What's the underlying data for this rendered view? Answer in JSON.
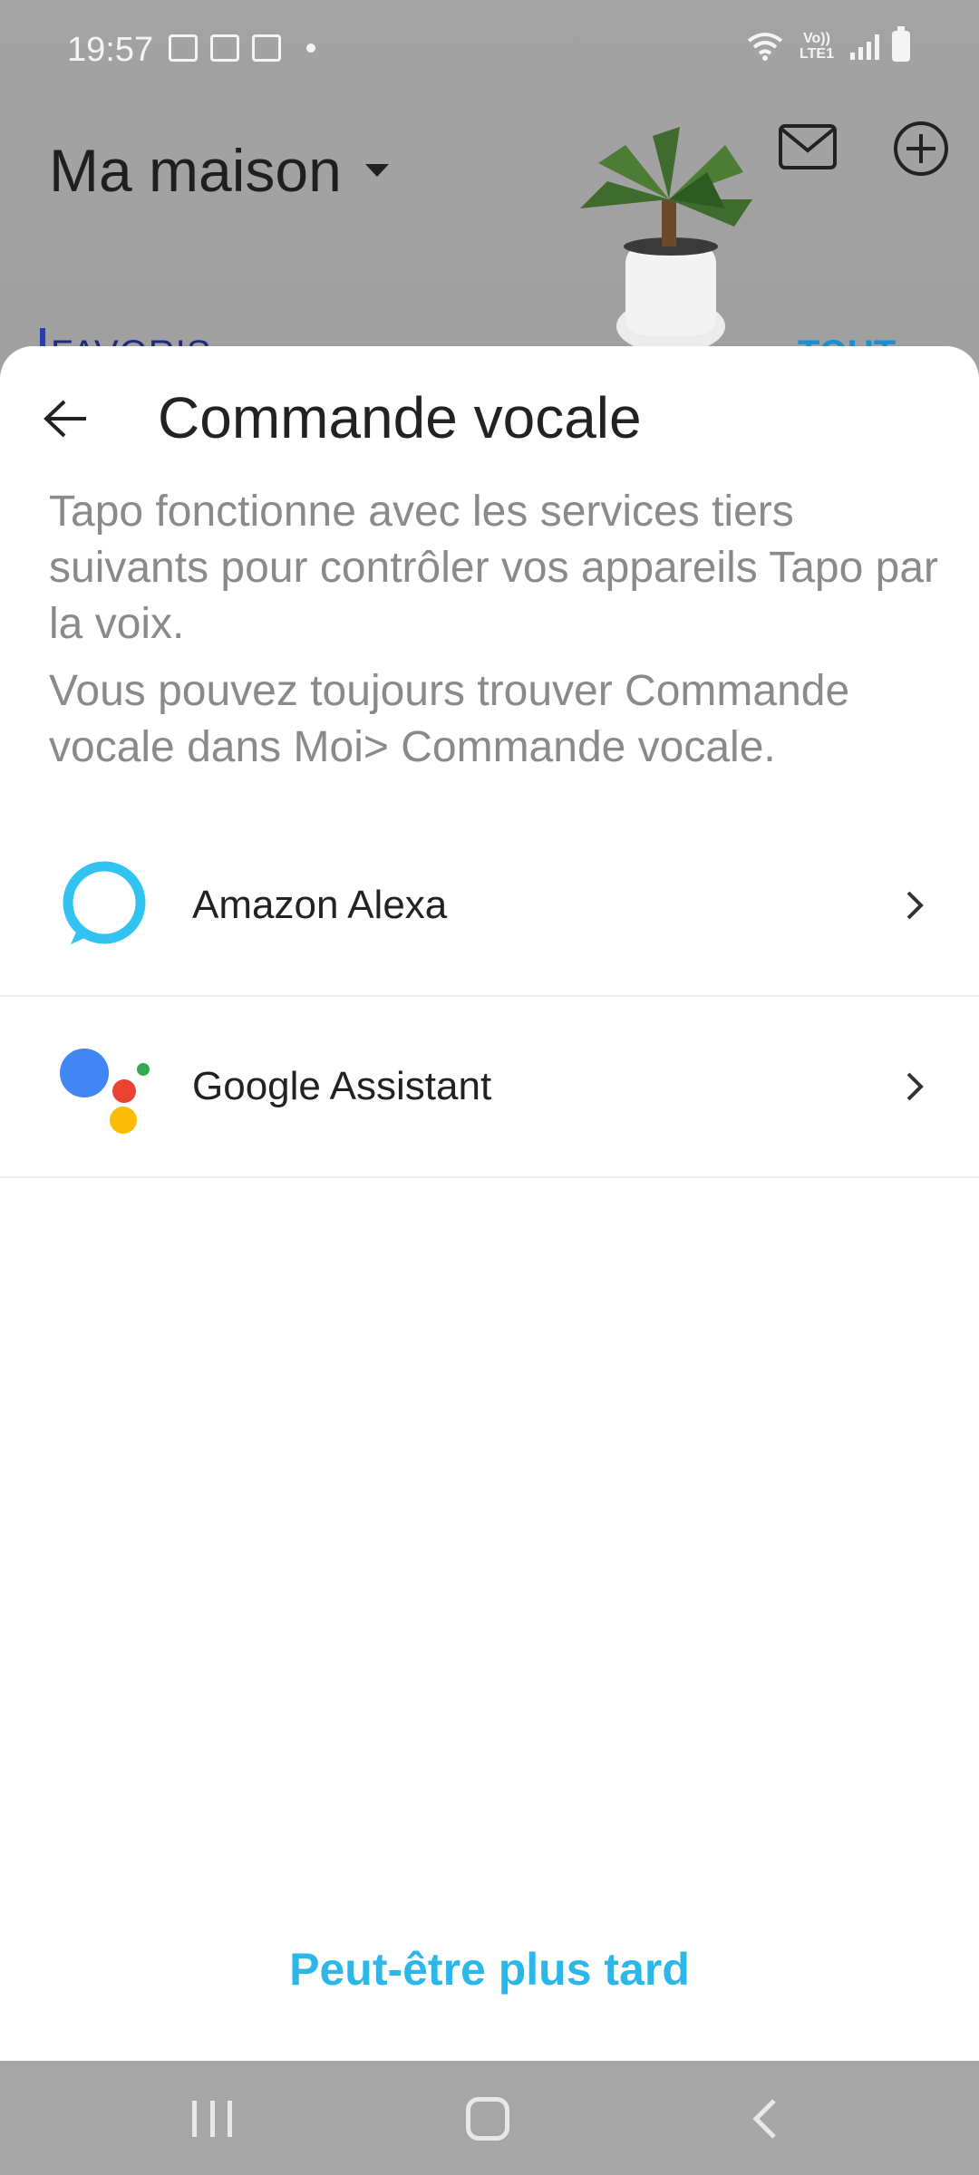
{
  "status_bar": {
    "time": "19:57",
    "network": "Vo)) LTE1",
    "left_icons": [
      "gallery-icon",
      "device-icon",
      "email-icon"
    ],
    "right_icons": [
      "wifi-icon",
      "signal-icon",
      "battery-icon"
    ]
  },
  "background": {
    "home_title": "Ma maison",
    "favorites_label": "FAVORIS",
    "all_label": "TOUT"
  },
  "sheet": {
    "title": "Commande vocale",
    "description_1": "Tapo fonctionne avec les services tiers suivants pour contrôler vos appareils Tapo par la voix.",
    "description_2": "Vous pouvez toujours trouver Commande vocale dans Moi> Commande vocale.",
    "services": [
      {
        "label": "Amazon Alexa",
        "icon": "alexa-icon"
      },
      {
        "label": "Google Assistant",
        "icon": "google-assistant-icon"
      }
    ],
    "later_button": "Peut-être plus tard"
  },
  "colors": {
    "accent": "#2bb7ea",
    "alexa": "#31c4f3",
    "google_blue": "#4285f4",
    "google_red": "#ea4335",
    "google_yellow": "#fbbc05",
    "google_green": "#34a853"
  }
}
